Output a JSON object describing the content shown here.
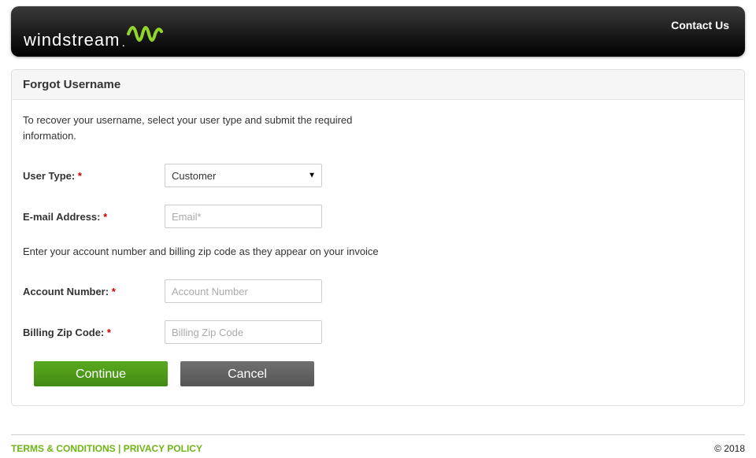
{
  "header": {
    "brand": "windstream",
    "contact": "Contact Us"
  },
  "panel": {
    "title": "Forgot Username",
    "intro": "To recover your username, select your user type and submit the required information.",
    "userType": {
      "label": "User Type:",
      "value": "Customer"
    },
    "email": {
      "label": "E-mail Address:",
      "placeholder": "Email*"
    },
    "instruction": "Enter your account number and billing zip code as they appear on your invoice",
    "account": {
      "label": "Account Number:",
      "placeholder": "Account Number"
    },
    "zip": {
      "label": "Billing Zip Code:",
      "placeholder": "Billing Zip Code"
    },
    "continue": "Continue",
    "cancel": "Cancel"
  },
  "footer": {
    "terms": "TERMS & CONDITIONS",
    "privacy": "PRIVACY POLICY",
    "sep": " | ",
    "copyright": "© 2018"
  }
}
